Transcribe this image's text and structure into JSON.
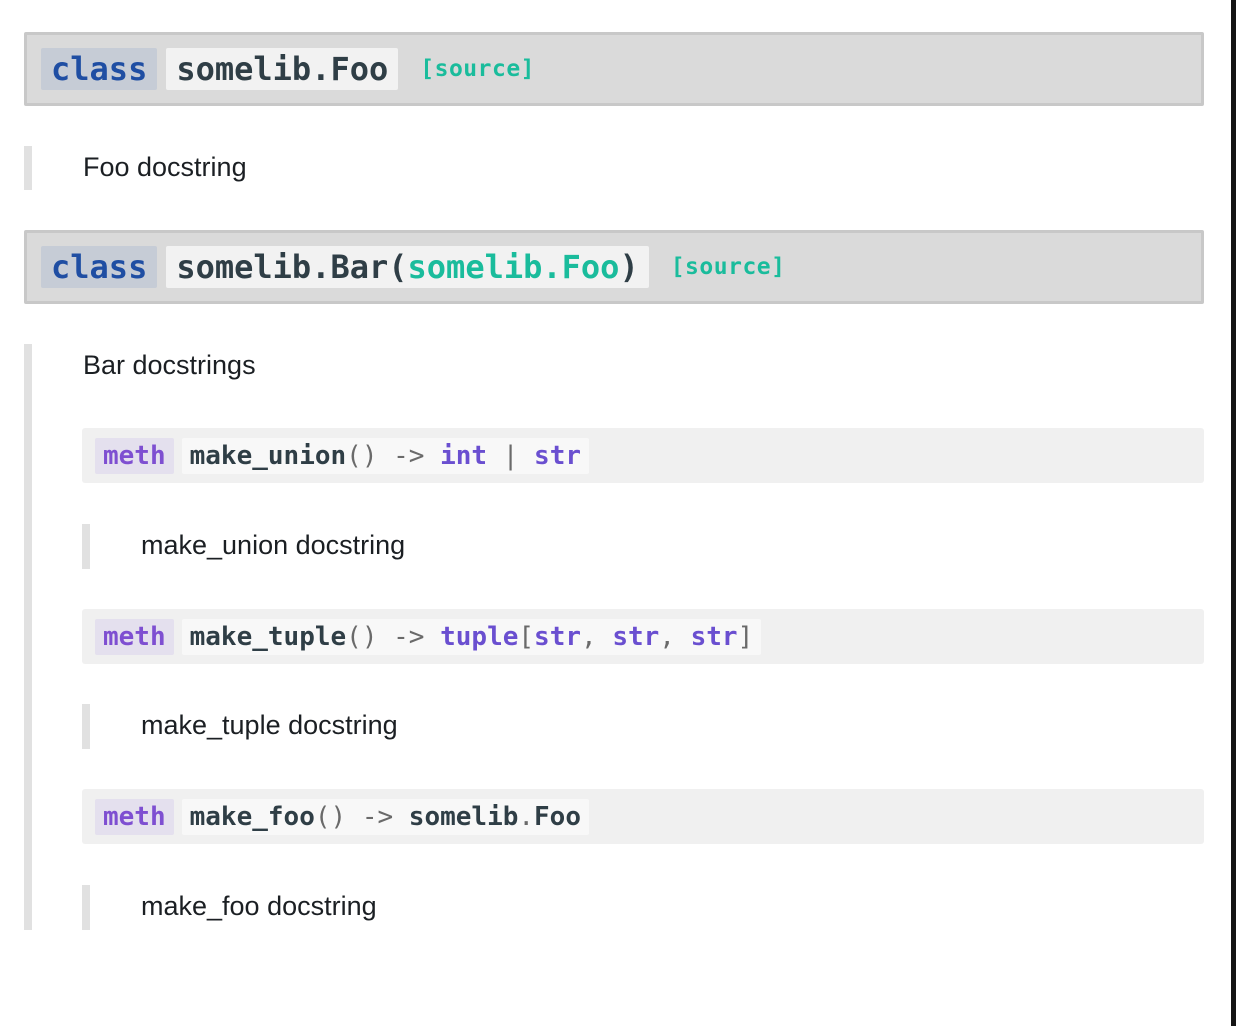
{
  "classes": [
    {
      "keyword": "class",
      "name": "somelib.Foo",
      "source": "[source]",
      "docstring": "Foo docstring"
    },
    {
      "keyword": "class",
      "name": "somelib.Bar",
      "open_paren": "(",
      "base": "somelib.Foo",
      "close_paren": ")",
      "source": "[source]",
      "docstring": "Bar docstrings"
    }
  ],
  "methods": [
    {
      "keyword": "meth",
      "name": "make_union",
      "parens": "()",
      "arrow": "->",
      "ret": [
        "int",
        "|",
        "str"
      ],
      "docstring": "make_union docstring"
    },
    {
      "keyword": "meth",
      "name": "make_tuple",
      "parens": "()",
      "arrow": "->",
      "ret": [
        "tuple",
        "[",
        "str",
        ",",
        "str",
        ",",
        "str",
        "]"
      ],
      "docstring": "make_tuple docstring"
    },
    {
      "keyword": "meth",
      "name": "make_foo",
      "parens": "()",
      "arrow": "->",
      "ret_module": "somelib",
      "ret_dot": ".",
      "ret_class": "Foo",
      "docstring": "make_foo docstring"
    }
  ],
  "colors": {
    "keyword_class": "#1f4ea3",
    "keyword_meth": "#7e4fd1",
    "source_link": "#1abc9c",
    "signature_bg": "#dadada",
    "method_bg": "#f0f0f0"
  }
}
